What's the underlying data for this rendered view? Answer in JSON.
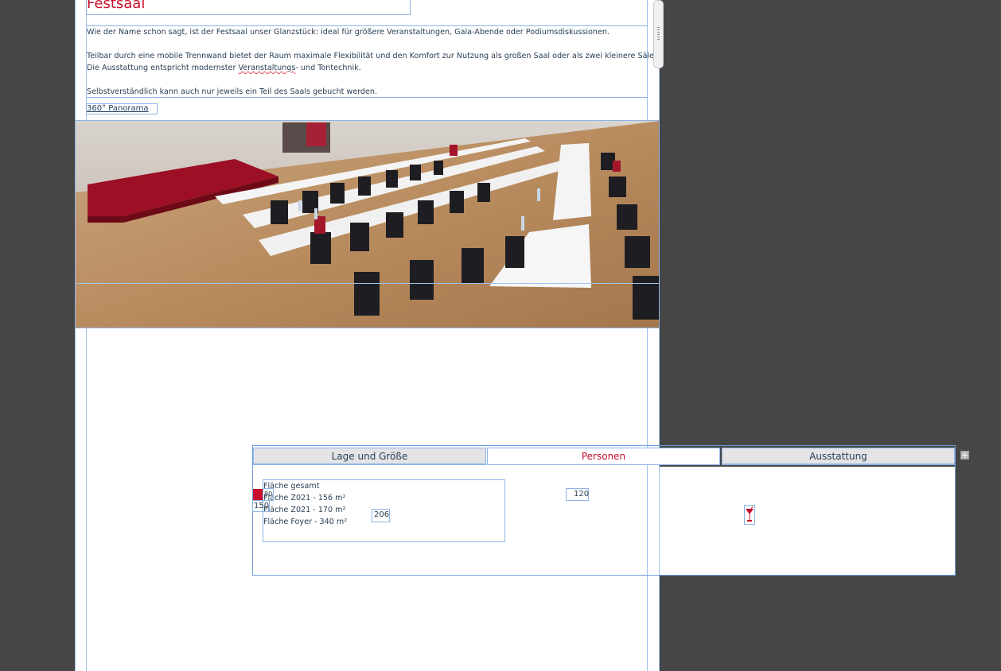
{
  "page": {
    "title": "Festsaal",
    "paragraphs": [
      "Wie der Name schon sagt, ist der Festsaal unser Glanzstück: ideal für größere Veranstaltungen,  Gala-Abende oder Podiumsdiskussionen.",
      "Teilbar durch eine mobile Trennwand bietet der Raum maximale Flexibilität und den Komfort zur Nutzung als großen Saal oder als zwei kleinere Säle.",
      "Selbstverständlich kann auch nur jeweils ein Teil des Saals gebucht werden."
    ],
    "line_ausstattung": {
      "before": "Die Ausstattung entspricht modernster ",
      "underlined": "Veranstaltungs",
      "after": "- und Tontechnik."
    },
    "panorama_link": "360° Panorama"
  },
  "tabs": [
    {
      "label": "Lage und Größe",
      "state": "inactive"
    },
    {
      "label": "Personen",
      "state": "active"
    },
    {
      "label": "Ausstattung",
      "state": "inactive"
    }
  ],
  "tab_content": {
    "flaeche_lines": [
      "Fläche gesamt",
      "Fläche Z021 - 156 m²",
      "Fläche Z021 - 170 m²",
      "Fläche Foyer - 340 m²"
    ],
    "value_206": "206",
    "value_120": "120",
    "value_150": "150",
    "value_small": "80"
  },
  "colors": {
    "accent": "#c8102e",
    "guide": "#8db4e6",
    "workspace": "#464646",
    "tab_inactive": "#e4e4e6"
  },
  "icons": {
    "add": "plus-icon",
    "equipment": "cocktail-glass-icon"
  }
}
